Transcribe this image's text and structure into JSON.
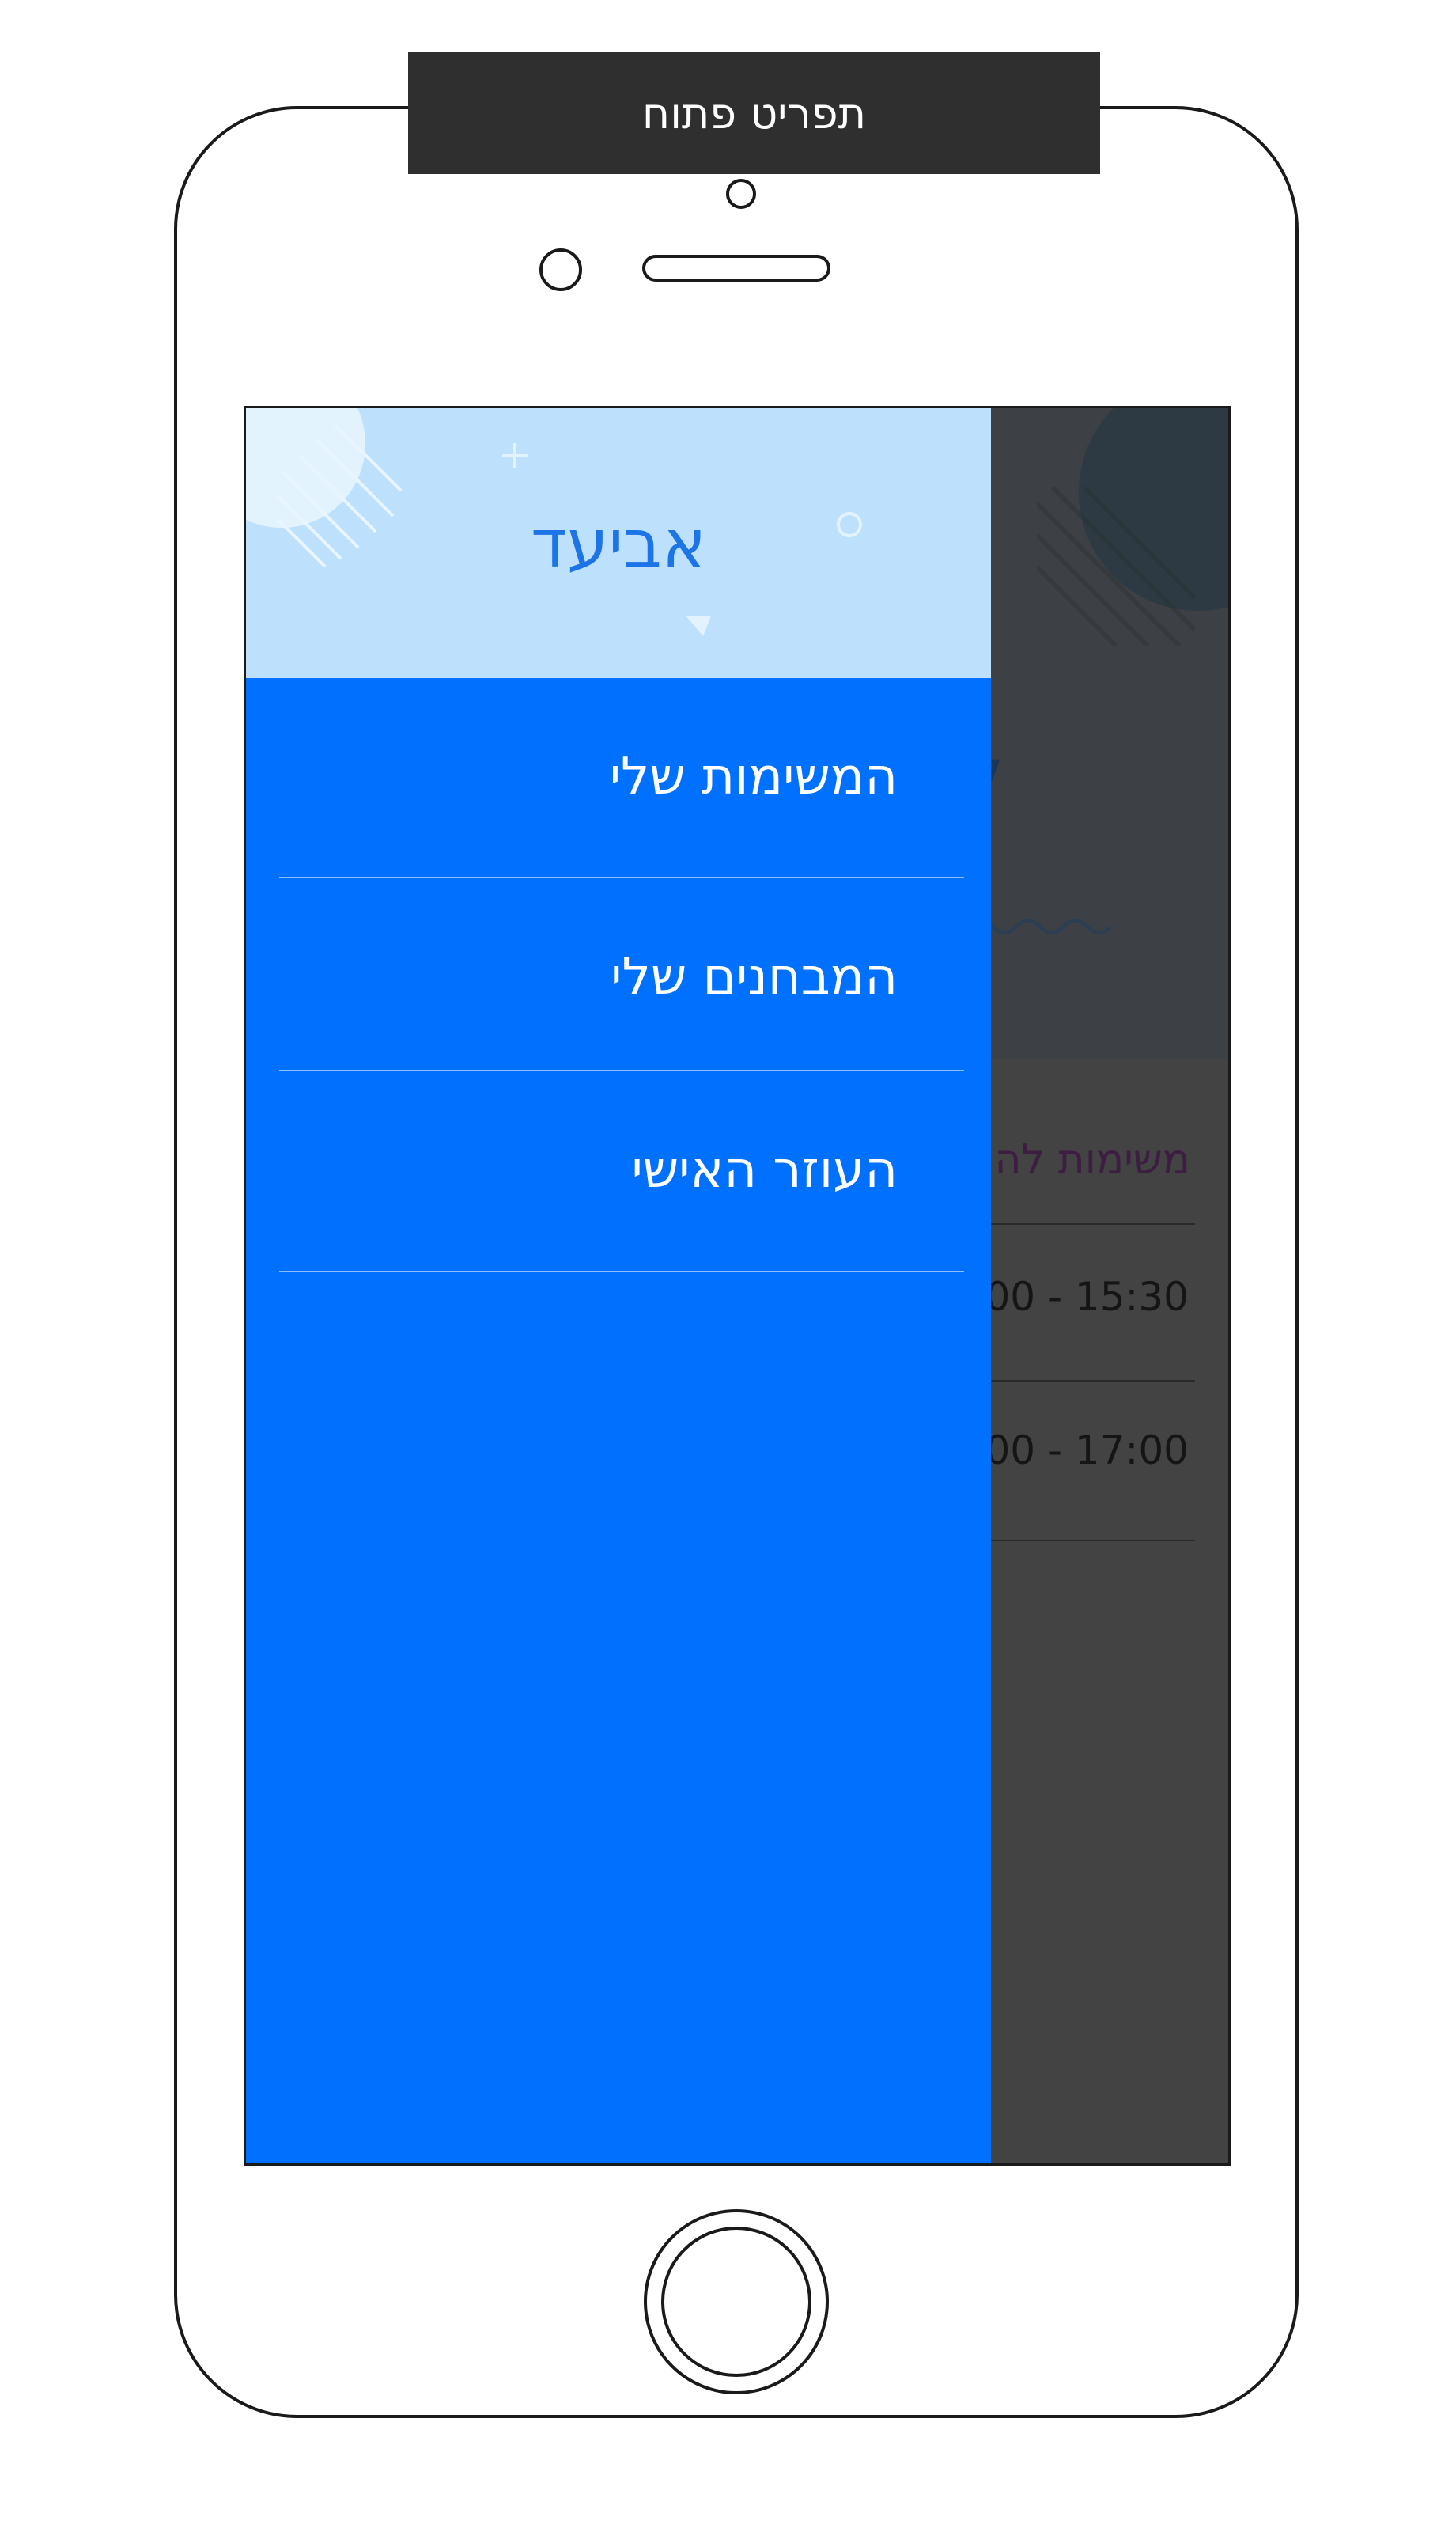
{
  "banner": {
    "label": "תפריט פתוח"
  },
  "drawer": {
    "user_name": "אביעד",
    "items": [
      {
        "label": "המשימות שלי"
      },
      {
        "label": "המבחנים שלי"
      },
      {
        "label": "העוזר האישי"
      }
    ]
  },
  "background_app": {
    "header_glyph_1": "י",
    "header_glyph_2": "7",
    "list_title": "משימות לה",
    "rows": [
      {
        "time": "00 - 15:30"
      },
      {
        "time": "00 - 17:00"
      }
    ]
  },
  "colors": {
    "drawer_background": "#0070ff",
    "drawer_header_background": "#bde1fd",
    "user_name_color": "#1c74e6",
    "overlay_background": "#434343",
    "banner_background": "#2f2f2f"
  },
  "icons": [
    "decorative-circle-icon",
    "decorative-stripes-icon",
    "plus-sparkle-icon",
    "ring-sparkle-icon",
    "triangle-sparkle-icon"
  ]
}
